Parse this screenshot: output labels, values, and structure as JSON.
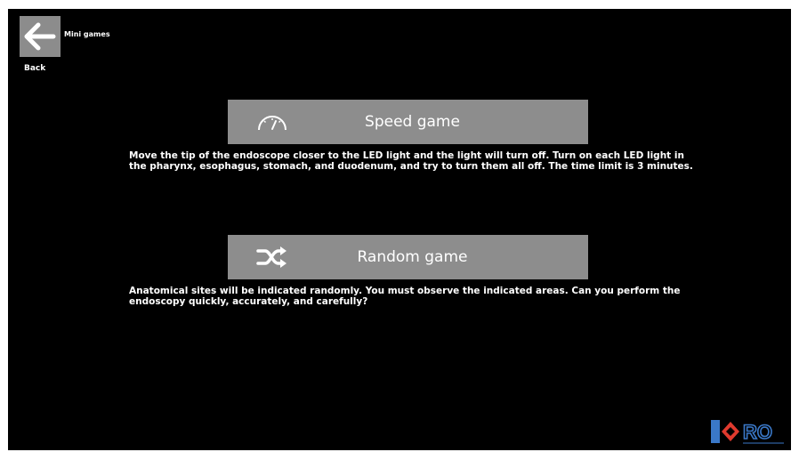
{
  "header": {
    "title": "Mini games",
    "back_label": "Back",
    "back_icon": "arrow-left-icon"
  },
  "games": [
    {
      "label": "Speed game",
      "icon": "speedometer-icon",
      "description": "Move the tip of the endoscope closer to the LED light and the light will turn off. Turn on each LED light in the pharynx, esophagus, stomach, and duodenum, and try to turn them all off. The time limit is 3 minutes."
    },
    {
      "label": "Random game",
      "icon": "shuffle-icon",
      "description": "Anatomical sites will be indicated randomly. You must observe the indicated areas. Can you perform the endoscopy quickly, accurately, and carefully?"
    }
  ],
  "logo": {
    "text": "RO",
    "icon": "brand-logo-icon"
  },
  "colors": {
    "background": "#000000",
    "button": "#8d8d8d",
    "text": "#ffffff",
    "logo_blue": "#3a78c8",
    "logo_red": "#e03a2e"
  }
}
